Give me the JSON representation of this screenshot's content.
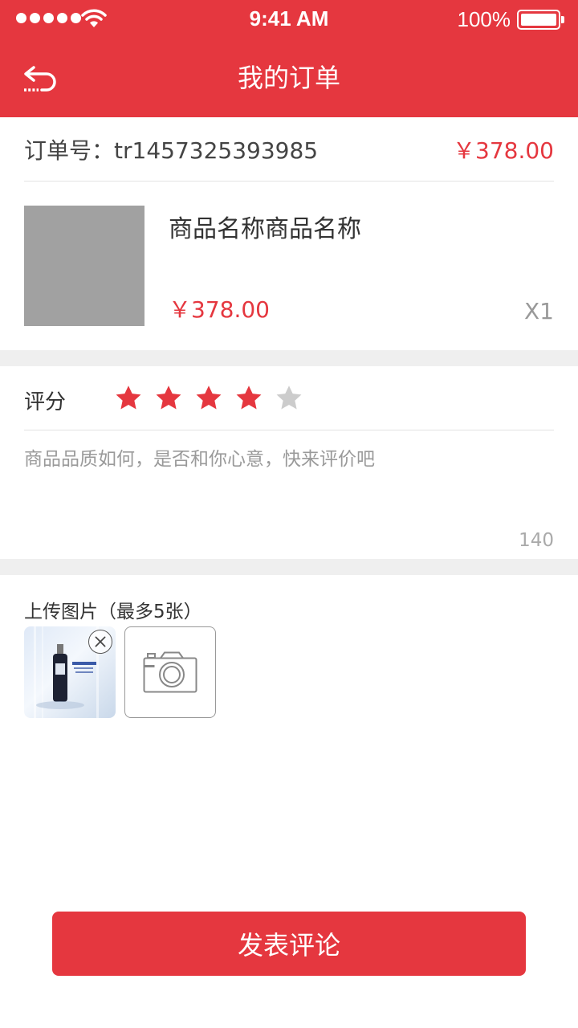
{
  "status_bar": {
    "time": "9:41 AM",
    "battery": "100%",
    "signal_icon": "signal-dots-icon",
    "wifi_icon": "wifi-icon",
    "battery_icon": "battery-icon"
  },
  "header": {
    "title": "我的订单",
    "back_icon": "back-arrow-icon"
  },
  "order": {
    "number_label": "订单号：",
    "number": "tr1457325393985",
    "total": "￥378.00"
  },
  "product": {
    "name": "商品名称商品名称",
    "price": "￥378.00",
    "quantity": "X1"
  },
  "rating": {
    "label": "评分",
    "value": 4,
    "max": 5,
    "star_icon": "star-icon"
  },
  "comment": {
    "placeholder": "商品品质如何，是否和你心意，快来评价吧",
    "max_length": "140"
  },
  "upload": {
    "label": "上传图片（最多5张）",
    "add_icon": "camera-icon",
    "remove_icon": "close-circle-icon"
  },
  "submit": {
    "label": "发表评论"
  },
  "colors": {
    "accent": "#e5373f",
    "separator": "#efefef",
    "star_empty": "#cccccc"
  }
}
